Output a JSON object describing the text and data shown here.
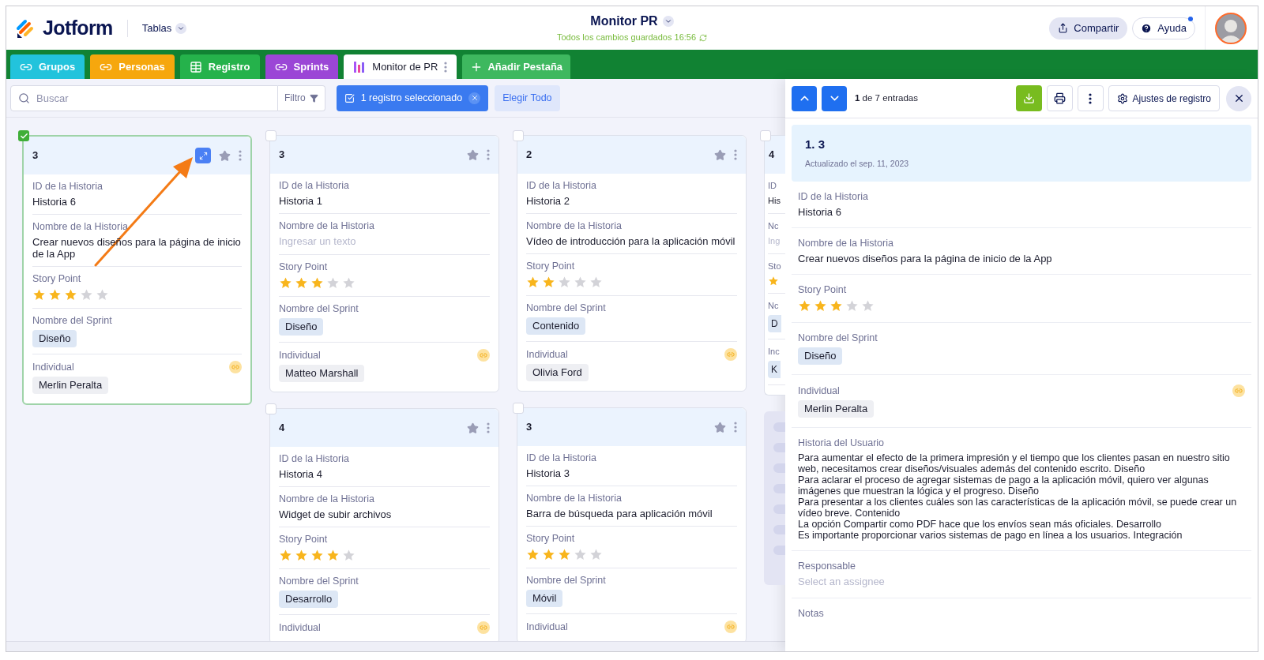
{
  "header": {
    "logo": "Jotform",
    "menu": "Tablas",
    "title": "Monitor PR",
    "save_status": "Todos los cambios guardados 16:56",
    "share_button": "Compartir",
    "help_button": "Ayuda",
    "help_notification": true
  },
  "tabs": [
    {
      "label": "Grupos",
      "kind": "link",
      "color": "#22c3dc",
      "selected": false
    },
    {
      "label": "Personas",
      "kind": "link",
      "color": "#f6a70d",
      "selected": false
    },
    {
      "label": "Registro",
      "kind": "table",
      "color": "#25b24b",
      "selected": false
    },
    {
      "label": "Sprints",
      "kind": "link",
      "color": "#9b46d6",
      "selected": false
    },
    {
      "label": "Monitor de PR",
      "kind": "report",
      "color": "#ffffff",
      "selected": true
    }
  ],
  "add_tab_button": "Añadir Pestaña",
  "toolbar": {
    "search_placeholder": "Buscar",
    "filter": "Filtro",
    "selection": "1 registro seleccionado",
    "select_all": "Elegir Todo"
  },
  "board": {
    "columns": [
      {
        "cards": [
          {
            "kind": "full",
            "number": "3",
            "checked": true,
            "expand_button": true,
            "fields": [
              {
                "label": "ID de la Historia",
                "kind": "text",
                "value": "Historia 6"
              },
              {
                "label": "Nombre de la Historia",
                "kind": "text",
                "value": "Crear nuevos diseños para la página de inicio de la App"
              },
              {
                "label": "Story Point",
                "kind": "stars",
                "stars": 3
              },
              {
                "label": "Nombre del Sprint",
                "kind": "tag",
                "value": "Diseño"
              },
              {
                "label": "Individual",
                "kind": "person",
                "value": "Merlin Peralta"
              }
            ]
          }
        ]
      },
      {
        "cards": [
          {
            "kind": "full",
            "number": "3",
            "checked": false,
            "expand_button": false,
            "fields": [
              {
                "label": "ID de la Historia",
                "kind": "text",
                "value": "Historia 1"
              },
              {
                "label": "Nombre de la Historia",
                "kind": "placeholder",
                "placeholder": "Ingresar un texto"
              },
              {
                "label": "Story Point",
                "kind": "stars",
                "stars": 3
              },
              {
                "label": "Nombre del Sprint",
                "kind": "tag",
                "value": "Diseño"
              },
              {
                "label": "Individual",
                "kind": "person",
                "value": "Matteo Marshall"
              }
            ]
          },
          {
            "kind": "full",
            "number": "4",
            "checked": false,
            "expand_button": false,
            "fields": [
              {
                "label": "ID de la Historia",
                "kind": "text",
                "value": "Historia 4"
              },
              {
                "label": "Nombre de la Historia",
                "kind": "text",
                "value": "Widget de subir archivos"
              },
              {
                "label": "Story Point",
                "kind": "stars",
                "stars": 4
              },
              {
                "label": "Nombre del Sprint",
                "kind": "tag",
                "value": "Desarrollo"
              },
              {
                "label": "Individual",
                "kind": "person"
              }
            ]
          }
        ]
      },
      {
        "cards": [
          {
            "kind": "full",
            "number": "2",
            "checked": false,
            "expand_button": false,
            "fields": [
              {
                "label": "ID de la Historia",
                "kind": "text",
                "value": "Historia 2"
              },
              {
                "label": "Nombre de la Historia",
                "kind": "text",
                "value": "Vídeo de introducción para la aplicación móvil"
              },
              {
                "label": "Story Point",
                "kind": "stars",
                "stars": 2
              },
              {
                "label": "Nombre del Sprint",
                "kind": "tag",
                "value": "Contenido"
              },
              {
                "label": "Individual",
                "kind": "person",
                "value": "Olivia Ford"
              }
            ]
          },
          {
            "kind": "full",
            "number": "3",
            "checked": false,
            "expand_button": false,
            "fields": [
              {
                "label": "ID de la Historia",
                "kind": "text",
                "value": "Historia 3"
              },
              {
                "label": "Nombre de la Historia",
                "kind": "text",
                "value": "Barra de búsqueda para aplicación móvil"
              },
              {
                "label": "Story Point",
                "kind": "stars",
                "stars": 3
              },
              {
                "label": "Nombre del Sprint",
                "kind": "tag",
                "value": "Móvil"
              },
              {
                "label": "Individual",
                "kind": "person"
              }
            ]
          }
        ]
      },
      {
        "cards": [
          {
            "kind": "partial",
            "number": "4",
            "checked": false,
            "fields": [
              {
                "label": "ID",
                "kind": "text",
                "value": "His"
              },
              {
                "label": "Nc",
                "kind": "placeholder",
                "placeholder": "Ing"
              },
              {
                "label": "Sto",
                "kind": "stars"
              },
              {
                "label": "Nc",
                "kind": "tag",
                "value": "D"
              },
              {
                "label": "Inc",
                "kind": "person",
                "value": "K"
              }
            ]
          },
          {
            "kind": "skeleton"
          }
        ]
      }
    ]
  },
  "panel": {
    "position": "**1** de 7 entradas",
    "settings_button": "Ajustes de registro",
    "record_title": "1. 3",
    "record_subtitle": "Actualizado el sep. 11, 2023",
    "fields": [
      {
        "label": "ID de la Historia",
        "kind": "text",
        "value": "Historia 6"
      },
      {
        "label": "Nombre de la Historia",
        "kind": "text",
        "value": "Crear nuevos diseños para la página de inicio de la App"
      },
      {
        "label": "Story Point",
        "kind": "stars",
        "stars": 3
      },
      {
        "label": "Nombre del Sprint",
        "kind": "tag",
        "value": "Diseño"
      },
      {
        "label": "Individual",
        "kind": "person",
        "value": "Merlin Peralta"
      },
      {
        "label": "Historia del Usuario",
        "kind": "paragraph",
        "value": "Para aumentar el efecto de la primera impresión y el tiempo que los clientes pasan en nuestro sitio web, necesitamos crear diseños/visuales además del contenido escrito. Diseño\nPara aclarar el proceso de agregar sistemas de pago a la aplicación móvil, quiero ver algunas imágenes que muestran la lógica y el progreso. Diseño\nPara presentar a los clientes cuáles son las características de la aplicación móvil, se puede crear un vídeo breve. Contenido\nLa opción Compartir como PDF hace que los envíos sean más oficiales. Desarrollo\nEs importante proporcionar varios sistemas de pago en línea a los usuarios. Integración"
      },
      {
        "label": "Responsable",
        "kind": "placeholder",
        "placeholder": "Select an assignee"
      },
      {
        "label": "Notas",
        "kind": "empty"
      }
    ]
  }
}
